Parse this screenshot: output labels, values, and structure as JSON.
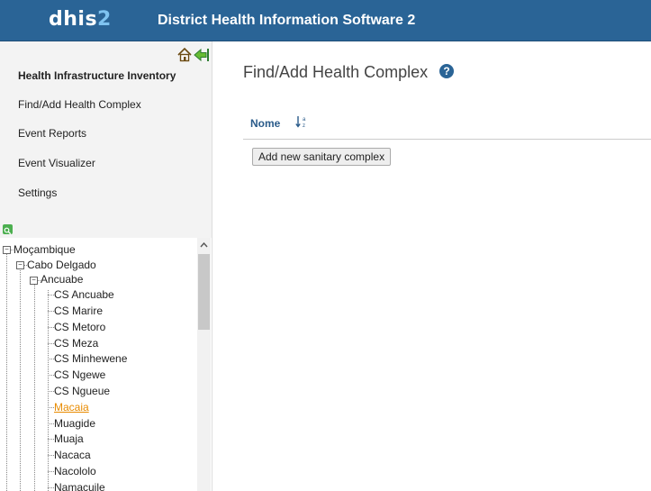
{
  "header": {
    "logo_main": "dhis",
    "logo_accent": "2",
    "app_title": "District Health Information Software 2"
  },
  "sidebar": {
    "menu": [
      {
        "label": "Health Infrastructure Inventory"
      },
      {
        "label": "Find/Add Health Complex"
      },
      {
        "label": "Event Reports"
      },
      {
        "label": "Event Visualizer"
      },
      {
        "label": "Settings"
      }
    ],
    "tree": {
      "root": "Moçambique",
      "province": "Cabo Delgado",
      "district": "Ancuabe",
      "facilities": [
        "CS Ancuabe",
        "CS Marire",
        "CS Metoro",
        "CS Meza",
        "CS Minhewene",
        "CS Ngewe",
        "CS Ngueue",
        "Macaia",
        "Muagide",
        "Muaja",
        "Nacaca",
        "Nacololo",
        "Namacuile"
      ],
      "selected": "Macaia"
    }
  },
  "main": {
    "title": "Find/Add Health Complex",
    "help_icon": "?",
    "sort_label": "Nome",
    "add_button": "Add new sanitary complex"
  }
}
